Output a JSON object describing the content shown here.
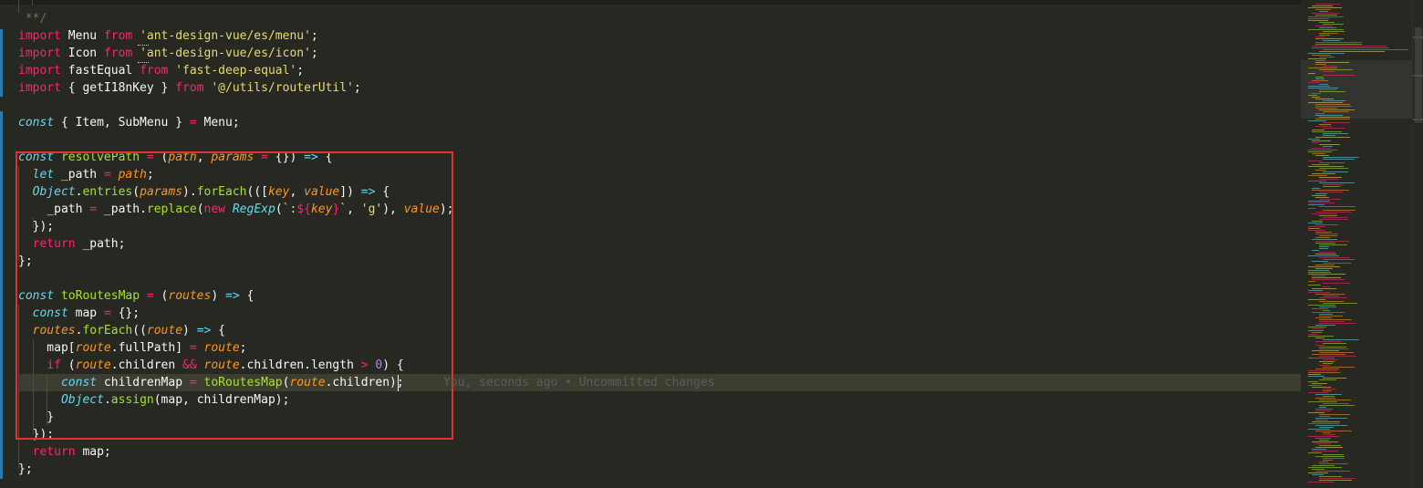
{
  "editor": {
    "blame_annotation": "You, seconds ago • Uncommitted changes",
    "lines": [
      [
        {
          "t": " **/",
          "c": "cm"
        }
      ],
      [
        {
          "t": "import",
          "c": "kw"
        },
        {
          "t": " Menu ",
          "c": "br"
        },
        {
          "t": "from",
          "c": "kw"
        },
        {
          "t": " ",
          "c": "br"
        },
        {
          "t": "'ant-design-vue/es/menu'",
          "c": "str"
        },
        {
          "t": ";",
          "c": "br"
        }
      ],
      [
        {
          "t": "import",
          "c": "kw"
        },
        {
          "t": " Icon ",
          "c": "br"
        },
        {
          "t": "from",
          "c": "kw"
        },
        {
          "t": " ",
          "c": "br"
        },
        {
          "t": "'ant-design-vue/es/icon'",
          "c": "str"
        },
        {
          "t": ";",
          "c": "br"
        }
      ],
      [
        {
          "t": "import",
          "c": "kw"
        },
        {
          "t": " fastEqual ",
          "c": "br"
        },
        {
          "t": "from",
          "c": "kw"
        },
        {
          "t": " ",
          "c": "br"
        },
        {
          "t": "'fast-deep-equal'",
          "c": "str"
        },
        {
          "t": ";",
          "c": "br"
        }
      ],
      [
        {
          "t": "import",
          "c": "kw"
        },
        {
          "t": " { getI18nKey } ",
          "c": "br"
        },
        {
          "t": "from",
          "c": "kw"
        },
        {
          "t": " ",
          "c": "br"
        },
        {
          "t": "'@/utils/routerUtil'",
          "c": "str"
        },
        {
          "t": ";",
          "c": "br"
        }
      ],
      [],
      [
        {
          "t": "const",
          "c": "st"
        },
        {
          "t": " { Item, SubMenu } ",
          "c": "br"
        },
        {
          "t": "=",
          "c": "kw"
        },
        {
          "t": " Menu;",
          "c": "br"
        }
      ],
      [],
      [
        {
          "t": "const",
          "c": "st"
        },
        {
          "t": " ",
          "c": "br"
        },
        {
          "t": "resolvePath",
          "c": "fn"
        },
        {
          "t": " ",
          "c": "br"
        },
        {
          "t": "=",
          "c": "kw"
        },
        {
          "t": " (",
          "c": "br"
        },
        {
          "t": "path",
          "c": "pa"
        },
        {
          "t": ", ",
          "c": "br"
        },
        {
          "t": "params",
          "c": "pa"
        },
        {
          "t": " ",
          "c": "br"
        },
        {
          "t": "=",
          "c": "kw"
        },
        {
          "t": " {}) ",
          "c": "br"
        },
        {
          "t": "=>",
          "c": "st"
        },
        {
          "t": " {",
          "c": "br"
        }
      ],
      [
        {
          "t": "  ",
          "c": "br"
        },
        {
          "t": "let",
          "c": "st"
        },
        {
          "t": " _path ",
          "c": "br"
        },
        {
          "t": "=",
          "c": "kw"
        },
        {
          "t": " ",
          "c": "br"
        },
        {
          "t": "path",
          "c": "pa"
        },
        {
          "t": ";",
          "c": "br"
        }
      ],
      [
        {
          "t": "  ",
          "c": "br"
        },
        {
          "t": "Object",
          "c": "st"
        },
        {
          "t": ".",
          "c": "br"
        },
        {
          "t": "entries",
          "c": "fn"
        },
        {
          "t": "(",
          "c": "br"
        },
        {
          "t": "params",
          "c": "pa"
        },
        {
          "t": ").",
          "c": "br"
        },
        {
          "t": "forEach",
          "c": "fn"
        },
        {
          "t": "(([",
          "c": "br"
        },
        {
          "t": "key",
          "c": "pa"
        },
        {
          "t": ", ",
          "c": "br"
        },
        {
          "t": "value",
          "c": "pa"
        },
        {
          "t": "]) ",
          "c": "br"
        },
        {
          "t": "=>",
          "c": "st"
        },
        {
          "t": " {",
          "c": "br"
        }
      ],
      [
        {
          "t": "    _path ",
          "c": "br"
        },
        {
          "t": "=",
          "c": "kw"
        },
        {
          "t": " _path.",
          "c": "br"
        },
        {
          "t": "replace",
          "c": "fn"
        },
        {
          "t": "(",
          "c": "br"
        },
        {
          "t": "new",
          "c": "kw"
        },
        {
          "t": " ",
          "c": "br"
        },
        {
          "t": "RegExp",
          "c": "st"
        },
        {
          "t": "(",
          "c": "br"
        },
        {
          "t": "`:",
          "c": "str"
        },
        {
          "t": "${",
          "c": "kw"
        },
        {
          "t": "key",
          "c": "pa"
        },
        {
          "t": "}",
          "c": "kw"
        },
        {
          "t": "`",
          "c": "str"
        },
        {
          "t": ", ",
          "c": "br"
        },
        {
          "t": "'g'",
          "c": "str"
        },
        {
          "t": "), ",
          "c": "br"
        },
        {
          "t": "value",
          "c": "pa"
        },
        {
          "t": ");",
          "c": "br"
        }
      ],
      [
        {
          "t": "  });",
          "c": "br"
        }
      ],
      [
        {
          "t": "  ",
          "c": "br"
        },
        {
          "t": "return",
          "c": "kw"
        },
        {
          "t": " _path;",
          "c": "br"
        }
      ],
      [
        {
          "t": "};",
          "c": "br"
        }
      ],
      [],
      [
        {
          "t": "const",
          "c": "st"
        },
        {
          "t": " ",
          "c": "br"
        },
        {
          "t": "toRoutesMap",
          "c": "fn"
        },
        {
          "t": " ",
          "c": "br"
        },
        {
          "t": "=",
          "c": "kw"
        },
        {
          "t": " (",
          "c": "br"
        },
        {
          "t": "routes",
          "c": "pa"
        },
        {
          "t": ") ",
          "c": "br"
        },
        {
          "t": "=>",
          "c": "st"
        },
        {
          "t": " {",
          "c": "br"
        }
      ],
      [
        {
          "t": "  ",
          "c": "br"
        },
        {
          "t": "const",
          "c": "st"
        },
        {
          "t": " map ",
          "c": "br"
        },
        {
          "t": "=",
          "c": "kw"
        },
        {
          "t": " {};",
          "c": "br"
        }
      ],
      [
        {
          "t": "  ",
          "c": "br"
        },
        {
          "t": "routes",
          "c": "pa"
        },
        {
          "t": ".",
          "c": "br"
        },
        {
          "t": "forEach",
          "c": "fn"
        },
        {
          "t": "((",
          "c": "br"
        },
        {
          "t": "route",
          "c": "pa"
        },
        {
          "t": ") ",
          "c": "br"
        },
        {
          "t": "=>",
          "c": "st"
        },
        {
          "t": " {",
          "c": "br"
        }
      ],
      [
        {
          "t": "    map[",
          "c": "br"
        },
        {
          "t": "route",
          "c": "pa"
        },
        {
          "t": ".fullPath] ",
          "c": "br"
        },
        {
          "t": "=",
          "c": "kw"
        },
        {
          "t": " ",
          "c": "br"
        },
        {
          "t": "route",
          "c": "pa"
        },
        {
          "t": ";",
          "c": "br"
        }
      ],
      [
        {
          "t": "    ",
          "c": "br"
        },
        {
          "t": "if",
          "c": "kw"
        },
        {
          "t": " (",
          "c": "br"
        },
        {
          "t": "route",
          "c": "pa"
        },
        {
          "t": ".children ",
          "c": "br"
        },
        {
          "t": "&&",
          "c": "kw"
        },
        {
          "t": " ",
          "c": "br"
        },
        {
          "t": "route",
          "c": "pa"
        },
        {
          "t": ".children.length ",
          "c": "br"
        },
        {
          "t": ">",
          "c": "kw"
        },
        {
          "t": " ",
          "c": "br"
        },
        {
          "t": "0",
          "c": "num"
        },
        {
          "t": ") {",
          "c": "br"
        }
      ],
      [
        {
          "t": "      ",
          "c": "br"
        },
        {
          "t": "const",
          "c": "st"
        },
        {
          "t": " childrenMap ",
          "c": "br"
        },
        {
          "t": "=",
          "c": "kw"
        },
        {
          "t": " ",
          "c": "br"
        },
        {
          "t": "toRoutesMap",
          "c": "fn"
        },
        {
          "t": "(",
          "c": "br"
        },
        {
          "t": "route",
          "c": "pa"
        },
        {
          "t": ".children);",
          "c": "br"
        }
      ],
      [
        {
          "t": "      ",
          "c": "br"
        },
        {
          "t": "Object",
          "c": "st"
        },
        {
          "t": ".",
          "c": "br"
        },
        {
          "t": "assign",
          "c": "fn"
        },
        {
          "t": "(map, childrenMap);",
          "c": "br"
        }
      ],
      [
        {
          "t": "    }",
          "c": "br"
        }
      ],
      [
        {
          "t": "  });",
          "c": "br"
        }
      ],
      [
        {
          "t": "  ",
          "c": "br"
        },
        {
          "t": "return",
          "c": "kw"
        },
        {
          "t": " map;",
          "c": "br"
        }
      ],
      [
        {
          "t": "};",
          "c": "br"
        }
      ]
    ]
  },
  "colors": {
    "background": "#272822",
    "keyword": "#f92672",
    "storage": "#66d9ef",
    "function": "#a6e22e",
    "parameter": "#fd971f",
    "string": "#e6db74",
    "number": "#ae81ff",
    "comment": "#75715e",
    "selection_border": "#e5302e",
    "git_gutter": "#2a7ab0"
  }
}
